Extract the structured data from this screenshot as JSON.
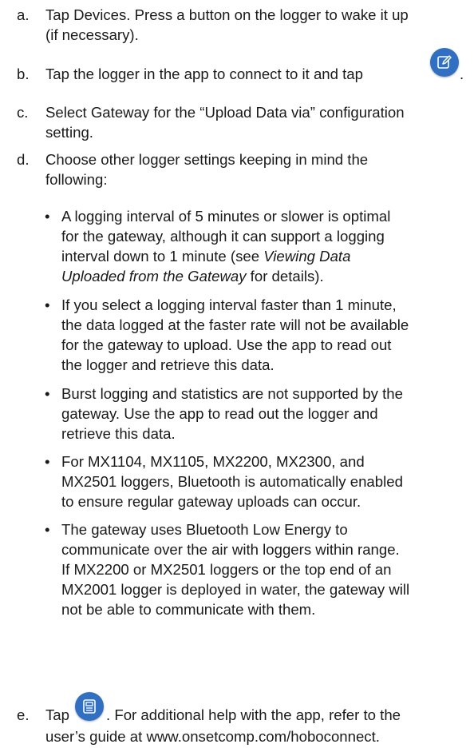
{
  "steps": [
    {
      "marker": "a.",
      "lines": [
        "Tap Devices. Press a button on the logger to wake it up",
        "(if necessary)."
      ]
    },
    {
      "marker": "b.",
      "text_before_icon": "Tap the logger in the app to connect to it and tap",
      "text_after_icon": ".",
      "icon": "edit-icon"
    },
    {
      "marker": "c.",
      "lines": [
        "Select Gateway for the “Upload Data via” configuration",
        "setting."
      ]
    },
    {
      "marker": "d.",
      "lines": [
        "Choose other logger settings keeping in mind the",
        "following:"
      ]
    },
    {
      "marker": "e.",
      "text_before_icon": "Tap",
      "text_after_icon": ". For additional help with the app, refer to the",
      "line2": "user’s guide at www.onsetcomp.com/hoboconnect.",
      "icon": "save-icon"
    }
  ],
  "bullets": [
    {
      "line1": "A logging interval of 5 minutes or slower is optimal",
      "line2": "for the gateway, although it can support a logging",
      "line3": "interval down to 1 minute (see",
      "line3_italic": "Viewing Data",
      "line4_italic": "Uploaded from the Gateway",
      "line4": " for details)."
    },
    {
      "lines": [
        "If you select a logging interval faster than 1 minute,",
        "the data logged at the faster rate will not be available",
        "for the gateway to upload. Use the app to read out",
        "the logger and retrieve this data."
      ]
    },
    {
      "lines": [
        "Burst logging and statistics are not supported by the",
        "gateway. Use the app to read out the logger and",
        "retrieve this data."
      ]
    },
    {
      "lines": [
        "For MX1104, MX1105, MX2200, MX2300, and",
        "MX2501 loggers, Bluetooth is automatically enabled",
        "to ensure regular gateway uploads can occur."
      ]
    },
    {
      "lines": [
        "The gateway uses Bluetooth Low Energy to",
        "communicate over the air with loggers within range.",
        "If MX2200 or MX2501 loggers or the top end of an",
        "MX2001 logger is deployed in water, the gateway will",
        "not be able to communicate with them."
      ]
    }
  ],
  "bullet_symbol": "•",
  "colors": {
    "icon_blue": "#2f6fc4",
    "text": "#1a1a1a"
  }
}
